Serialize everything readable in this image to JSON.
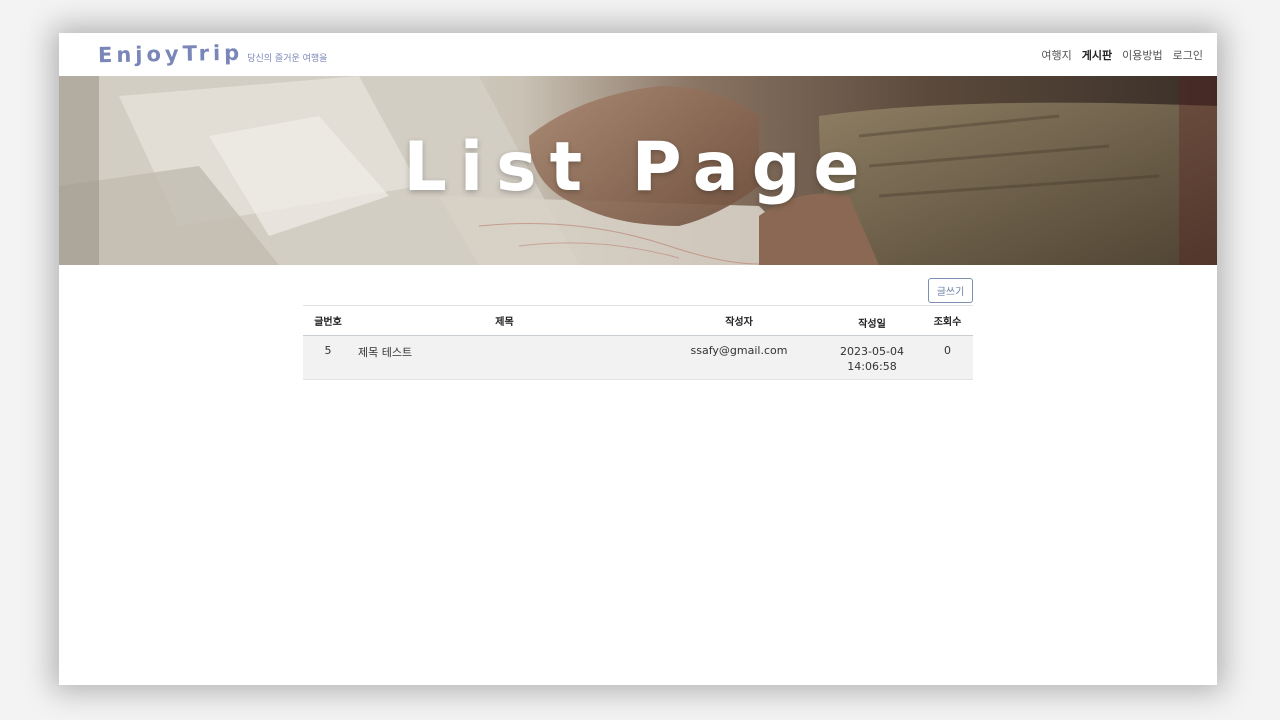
{
  "brand": {
    "logo": "EnjoyTrip",
    "tagline": "당신의 즐거운 여행을"
  },
  "nav": {
    "items": [
      {
        "label": "여행지",
        "active": false
      },
      {
        "label": "게시판",
        "active": true
      },
      {
        "label": "이용방법",
        "active": false
      },
      {
        "label": "로그인",
        "active": false
      }
    ]
  },
  "hero": {
    "title": "List Page"
  },
  "toolbar": {
    "write_label": "글쓰기"
  },
  "table": {
    "headers": {
      "no": "글번호",
      "title": "제목",
      "author": "작성자",
      "date": "작성일",
      "hit": "조회수"
    },
    "rows": [
      {
        "no": "5",
        "title": "제목 테스트",
        "author": "ssafy@gmail.com",
        "date_day": "2023-05-04",
        "date_time": "14:06:58",
        "hit": "0"
      }
    ]
  },
  "colors": {
    "brand": "#7a86b8",
    "button_border": "#7b8fb2",
    "row_bg": "#f2f2f2"
  }
}
